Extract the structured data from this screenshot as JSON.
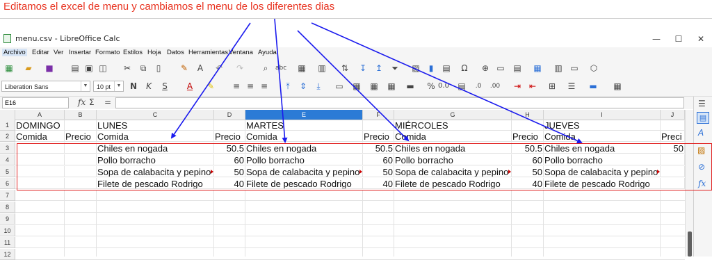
{
  "annotation": {
    "text": "Editamos el excel de menu y cambiamos el menu de los diferentes dias",
    "arrow_color": "#1a1aee",
    "text_color": "#e8321f",
    "box_color": "#e02020"
  },
  "window": {
    "title": "menu.csv - LibreOffice Calc",
    "controls": [
      "—",
      "☐",
      "✕"
    ]
  },
  "menu": [
    "Archivo",
    "Editar",
    "Ver",
    "Insertar",
    "Formato",
    "Estilos",
    "Hoja",
    "Datos",
    "Herramientas",
    "Ventana",
    "Ayuda"
  ],
  "toolbar": {
    "font_name": "Liberation Sans",
    "font_size": "10 pt"
  },
  "formula_bar": {
    "cell_ref": "E16",
    "fx": "fx",
    "sum": "Σ",
    "equals": "=",
    "value": ""
  },
  "columns": [
    "A",
    "B",
    "C",
    "D",
    "E",
    "F",
    "G",
    "H",
    "I",
    "J"
  ],
  "selected_column": "E",
  "rows": [
    "1",
    "2",
    "3",
    "4",
    "5",
    "6",
    "7",
    "8",
    "9",
    "10",
    "11",
    "12"
  ],
  "sheet": {
    "row1": {
      "A": "DOMINGO",
      "C": "LUNES",
      "E": "MARTES",
      "G": "MIÉRCOLES",
      "I": "JUEVES"
    },
    "row2": {
      "A": "Comida",
      "B": "Precio",
      "C": "Comida",
      "D": "Precio",
      "E": "Comida",
      "F": "Precio",
      "G": "Comida",
      "H": "Precio",
      "I": "Comida",
      "J": "Preci"
    },
    "dishes": [
      {
        "name": "Chiles en nogada",
        "price": "50.5",
        "price_j": "50"
      },
      {
        "name": "Pollo borracho",
        "price": "60",
        "price_j": ""
      },
      {
        "name": "Sopa de calabacita y pepino",
        "price": "50",
        "price_j": ""
      },
      {
        "name": "Filete de pescado Rodrigo",
        "price": "40",
        "price_j": ""
      }
    ]
  }
}
